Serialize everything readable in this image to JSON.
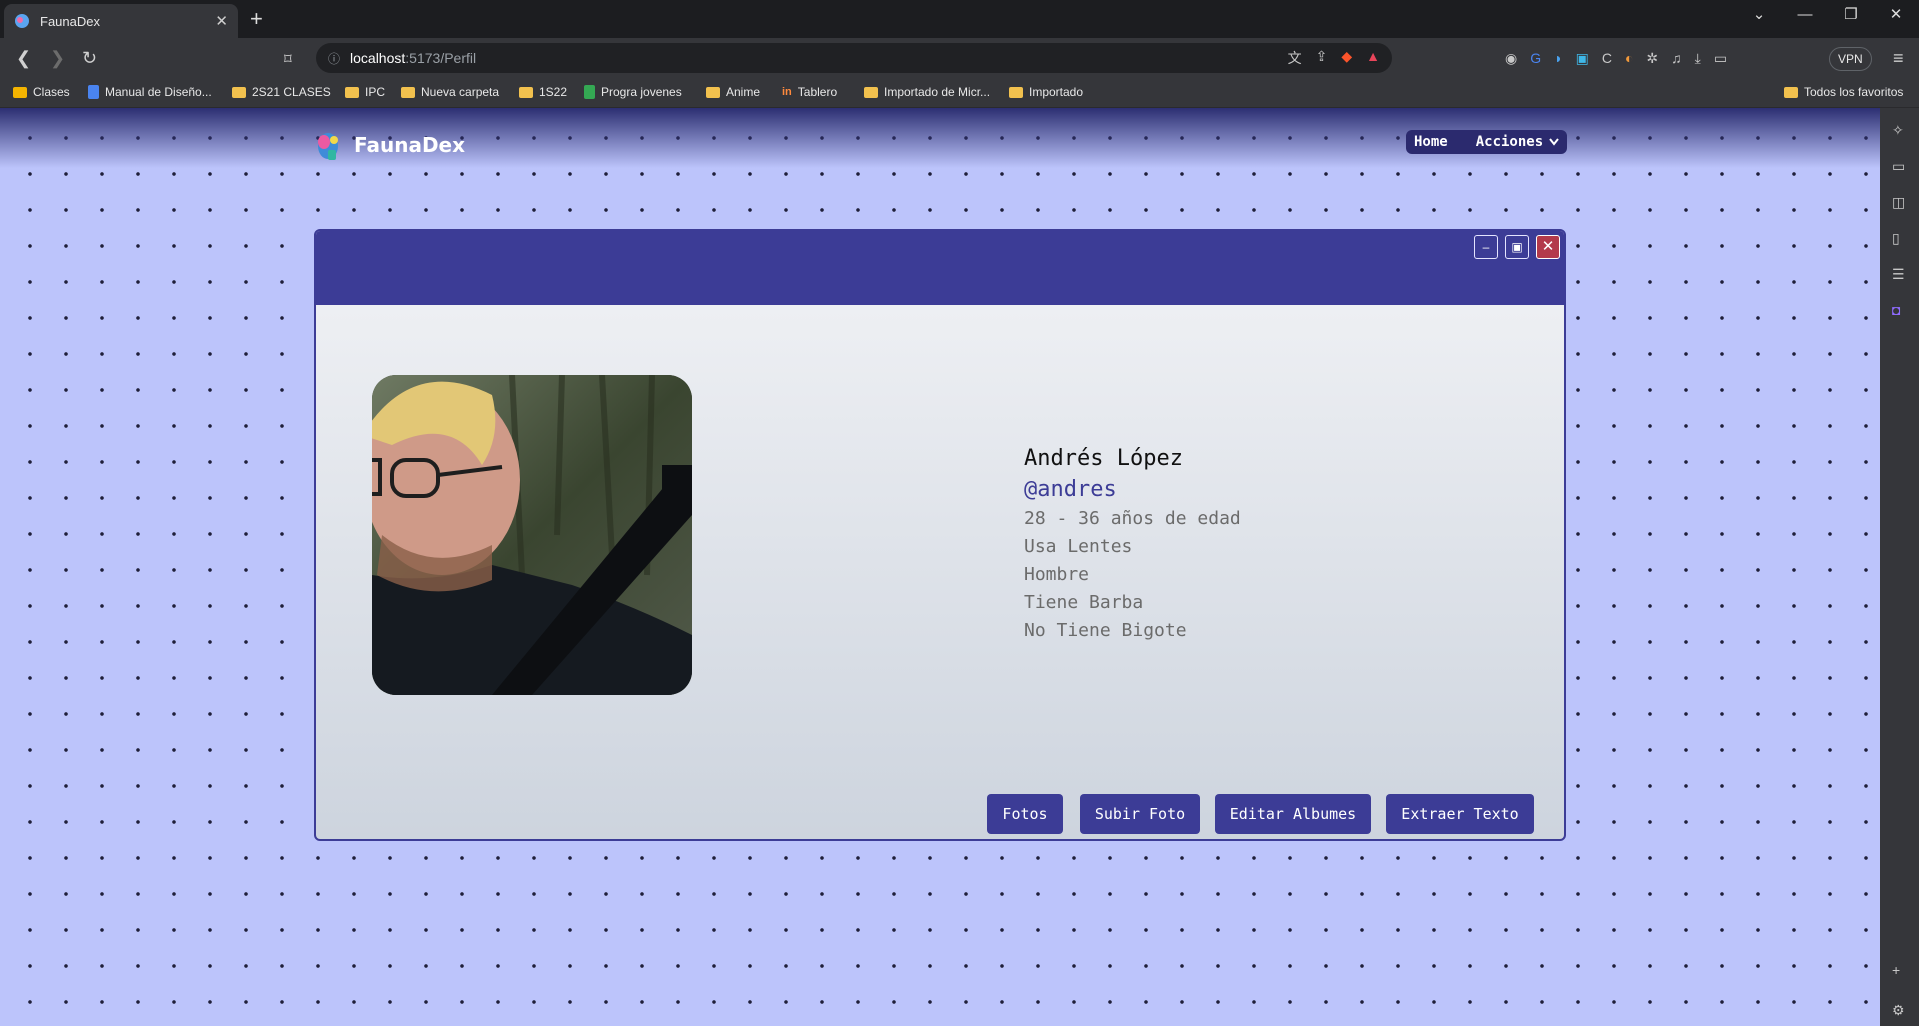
{
  "browser": {
    "tab_title": "FaunaDex",
    "tab_close": "✕",
    "new_tab": "+",
    "window_controls": [
      "⌄",
      "—",
      "❐",
      "✕"
    ],
    "url_host": "localhost",
    "url_path": ":5173/Perfil",
    "vpn_label": "VPN",
    "bookmarks": [
      {
        "label": "Clases",
        "icon": "image-icon"
      },
      {
        "label": "Manual de Diseño...",
        "icon": "doc-icon"
      },
      {
        "label": "2S21 CLASES",
        "icon": "folder-icon"
      },
      {
        "label": "IPC",
        "icon": "folder-icon"
      },
      {
        "label": "Nueva carpeta",
        "icon": "folder-icon"
      },
      {
        "label": "1S22",
        "icon": "folder-icon"
      },
      {
        "label": "Progra jovenes",
        "icon": "sheet-icon"
      },
      {
        "label": "Anime",
        "icon": "folder-icon"
      },
      {
        "label": "Tablero",
        "icon": "hub-icon"
      },
      {
        "label": "Importado de Micr...",
        "icon": "folder-icon"
      },
      {
        "label": "Importado",
        "icon": "folder-icon"
      }
    ],
    "bookmarks_right": "Todos los favoritos"
  },
  "app": {
    "brand": "FaunaDex",
    "nav": {
      "home": "Home",
      "actions": "Acciones"
    }
  },
  "modal": {
    "controls": {
      "minimize": "–",
      "maximize": "▣",
      "close": "✕"
    },
    "profile": {
      "full_name": "Andrés López",
      "username": "@andres",
      "details": [
        "28 - 36 años de edad",
        "Usa Lentes",
        "Hombre",
        "Tiene Barba",
        "No Tiene Bigote"
      ]
    },
    "buttons": [
      "Fotos",
      "Subir Foto",
      "Editar Albumes",
      "Extraer Texto"
    ]
  },
  "colors": {
    "accent": "#3c3c96",
    "page_bg": "#bcc4fb",
    "close": "#b33a4b"
  }
}
